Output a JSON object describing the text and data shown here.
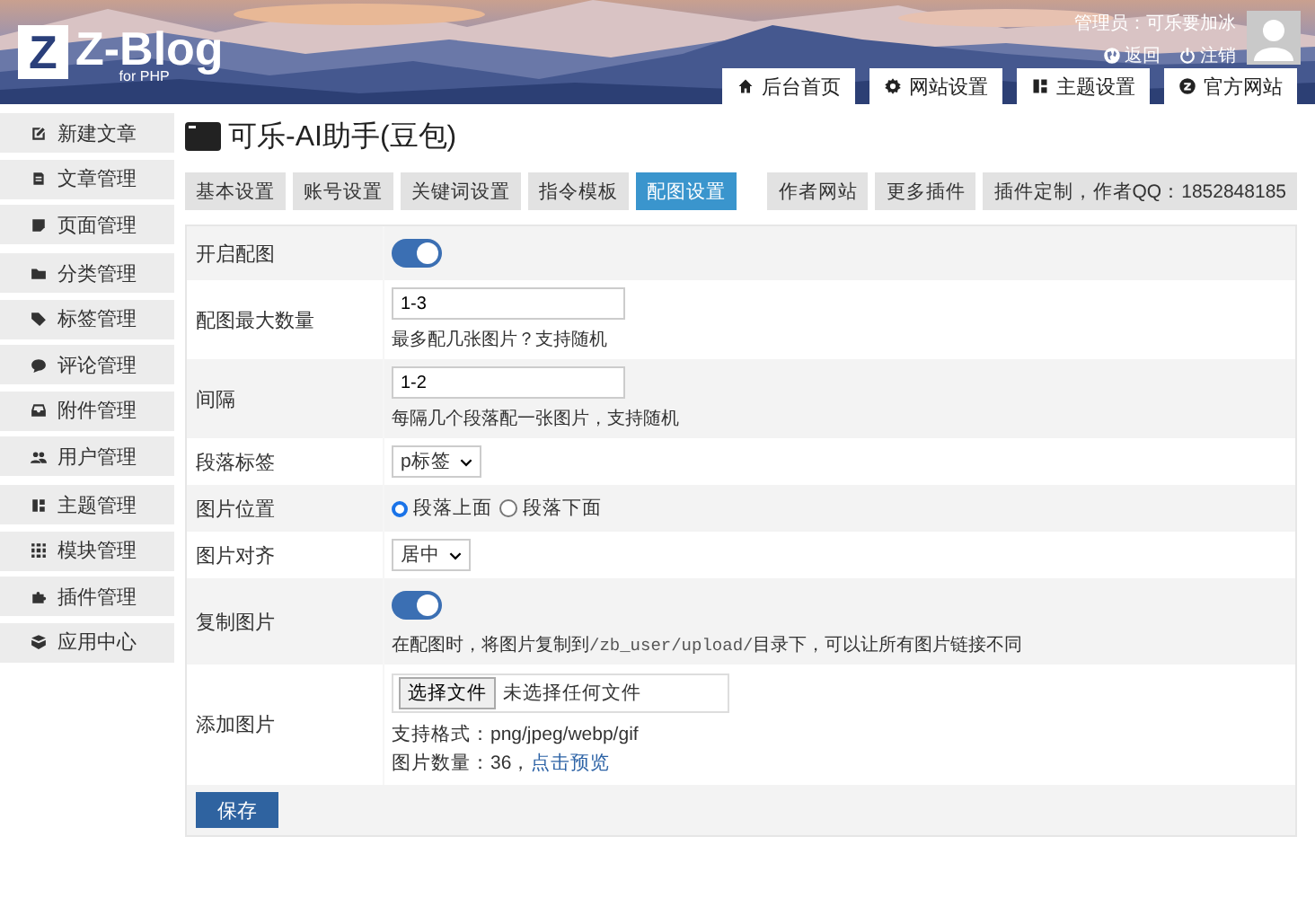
{
  "header": {
    "logo_letter": "Z",
    "logo_name": "Z-Blog",
    "logo_sub": "for PHP",
    "user": "管理员：可乐要加冰",
    "links": [
      {
        "label": "返回"
      },
      {
        "label": "注销"
      }
    ],
    "nav": [
      {
        "label": "后台首页"
      },
      {
        "label": "网站设置"
      },
      {
        "label": "主题设置"
      },
      {
        "label": "官方网站"
      }
    ]
  },
  "sidebar": {
    "groups": [
      [
        {
          "label": "新建文章"
        },
        {
          "label": "文章管理"
        },
        {
          "label": "页面管理"
        }
      ],
      [
        {
          "label": "分类管理"
        },
        {
          "label": "标签管理"
        },
        {
          "label": "评论管理"
        },
        {
          "label": "附件管理"
        },
        {
          "label": "用户管理"
        }
      ],
      [
        {
          "label": "主题管理"
        },
        {
          "label": "模块管理"
        },
        {
          "label": "插件管理"
        },
        {
          "label": "应用中心"
        }
      ]
    ]
  },
  "page_title": "可乐-AI助手(豆包)",
  "tabs": [
    {
      "label": "基本设置",
      "selected": false
    },
    {
      "label": "账号设置",
      "selected": false
    },
    {
      "label": "关键词设置",
      "selected": false
    },
    {
      "label": "指令模板",
      "selected": false
    },
    {
      "label": "配图设置",
      "selected": true
    }
  ],
  "right_links": [
    "作者网站",
    "更多插件",
    "插件定制，作者QQ：1852848185"
  ],
  "rows": [
    {
      "kind": "toggle",
      "label": "开启配图",
      "on": true
    },
    {
      "kind": "input",
      "label": "配图最大数量",
      "value": "1-3",
      "hint": "最多配几张图片？支持随机"
    },
    {
      "kind": "input",
      "label": "间隔",
      "value": "1-2",
      "hint": "每隔几个段落配一张图片，支持随机"
    },
    {
      "kind": "select",
      "label": "段落标签",
      "value": "p标签"
    },
    {
      "kind": "radio",
      "label": "图片位置",
      "options": [
        {
          "label": "段落上面",
          "selected": true
        },
        {
          "label": "段落下面",
          "selected": false
        }
      ]
    },
    {
      "kind": "select",
      "label": "图片对齐",
      "value": "居中"
    },
    {
      "kind": "toggle",
      "label": "复制图片",
      "on": true,
      "note": {
        "before": "在配图时，将图片复制到",
        "code": "/zb_user/upload/",
        "after": "目录下，可以让所有图片链接不同"
      }
    },
    {
      "kind": "file",
      "label": "添加图片",
      "button": "选择文件",
      "status": "未选择任何文件",
      "formats": "支持格式：png/jpeg/webp/gif",
      "count": "图片数量：36，",
      "link": "点击预览"
    }
  ],
  "save": "保存"
}
